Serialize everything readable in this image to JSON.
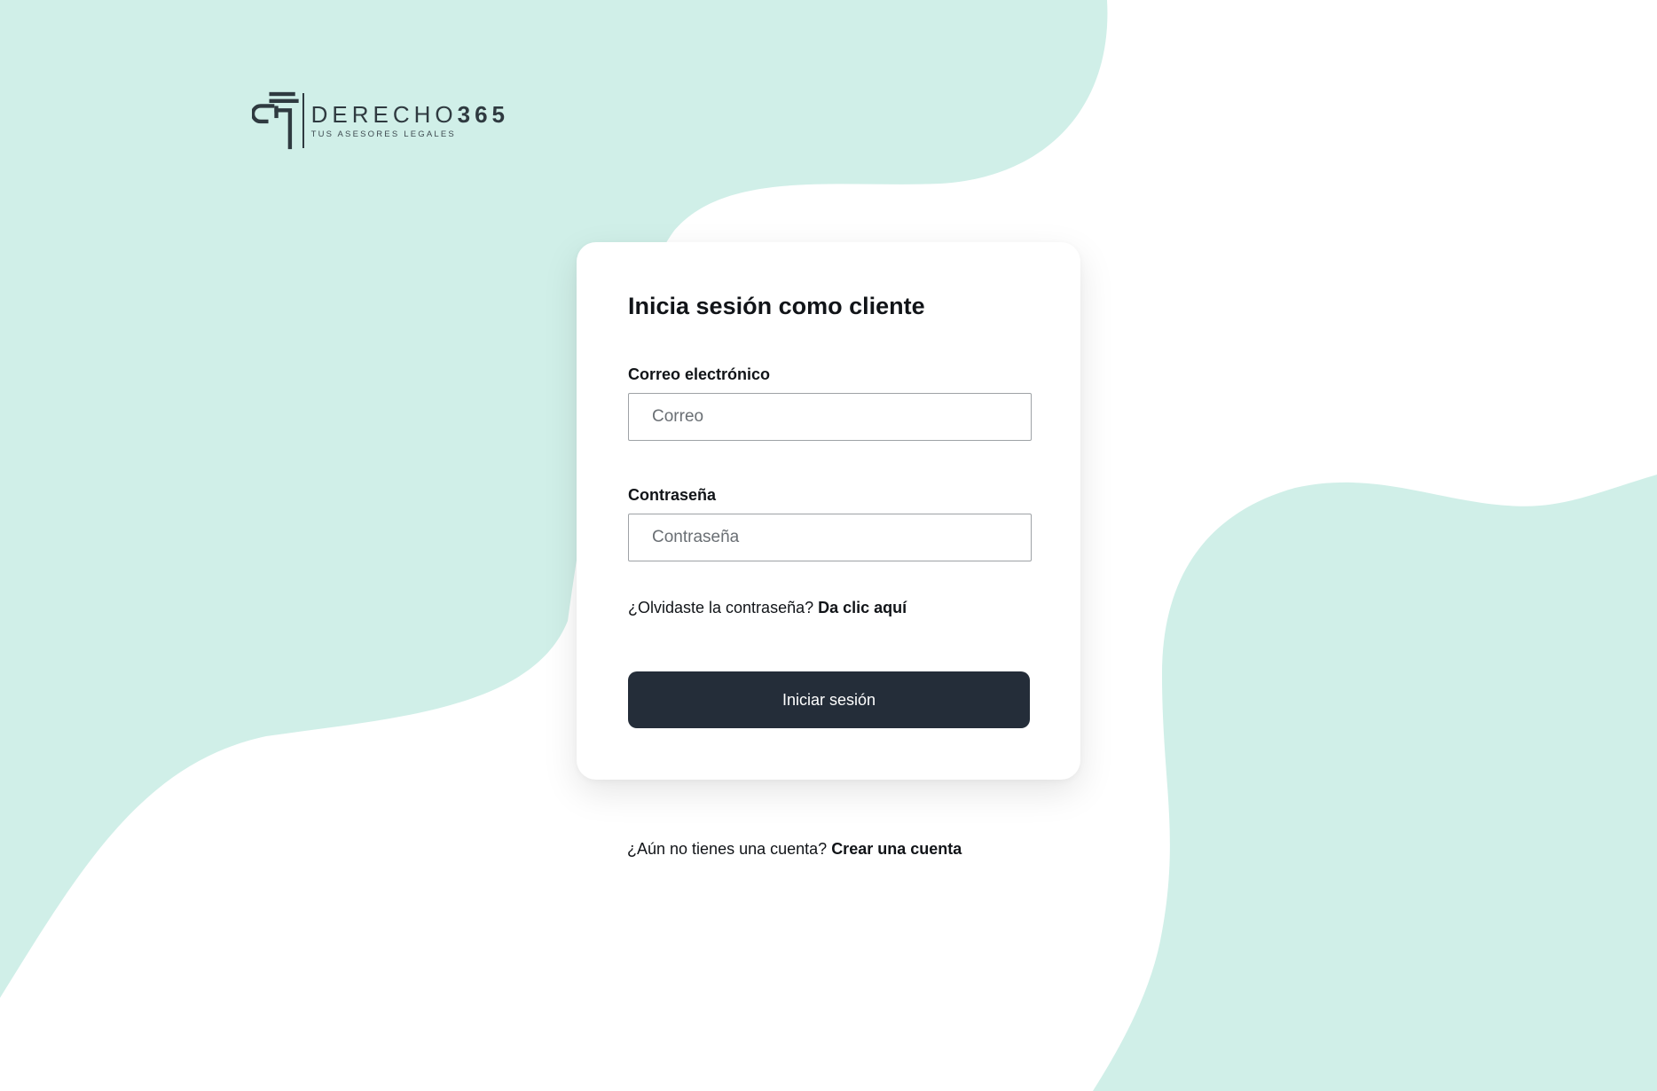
{
  "theme": {
    "background": "#ffffff",
    "blob_color": "#d0efe8",
    "primary_button": "#242d39",
    "text": "#111418",
    "logo_color": "#2f3a40"
  },
  "brand": {
    "name_light": "DERECHO",
    "name_bold": "365",
    "tagline": "TUS ASESORES LEGALES",
    "icon": "derecho365-logo-icon"
  },
  "login": {
    "title": "Inicia sesión como cliente",
    "email_label": "Correo electrónico",
    "email_placeholder": "Correo",
    "email_value": "",
    "password_label": "Contraseña",
    "password_placeholder": "Contraseña",
    "password_value": "",
    "forgot_text": "¿Olvidaste la contraseña?",
    "forgot_link": "Da clic aquí",
    "submit_label": "Iniciar sesión"
  },
  "signup": {
    "text": "¿Aún no tienes una cuenta?",
    "link": "Crear una cuenta"
  }
}
